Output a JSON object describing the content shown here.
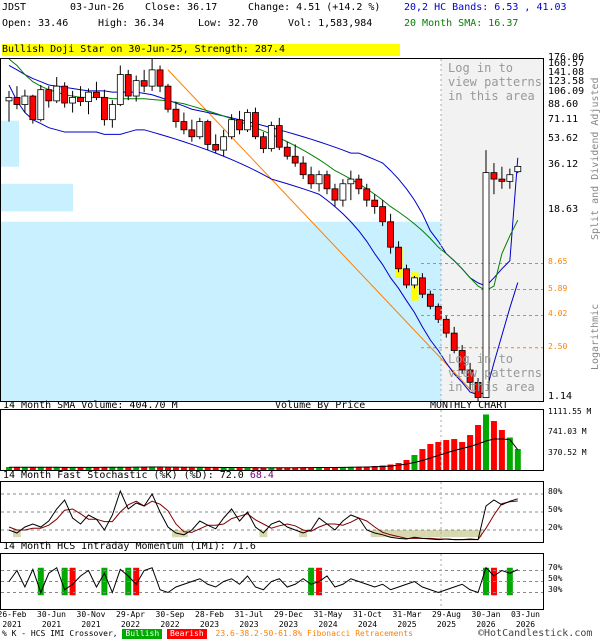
{
  "header": {
    "symbol": "JDST",
    "date": "03-Jun-26",
    "close_label": "Close: 36.17",
    "change_label": "Change: 4.51 (+14.2 %)",
    "open_label": "Open: 33.46",
    "high_label": "High: 36.34",
    "low_label": "Low: 32.70",
    "vol_label": "Vol: 1,583,984",
    "bands_label": "20,2 HC Bands: 6.53 , 41.03",
    "sma_label": "20 Month SMA: 16.37"
  },
  "pattern_banner": "Bullish Doji Star on 30-Jun-25, Strength: 287.4",
  "notes": {
    "top": "Log in to\nview patterns\nin this area",
    "bottom": "Log in to\nview patterns\nin this area"
  },
  "side_labels": {
    "split": "Split and Dividend Adjusted",
    "log": "Logarithmic"
  },
  "price_axis": {
    "labels": [
      "176.06",
      "160.57",
      "141.08",
      "123.58",
      "106.09",
      "88.60",
      "71.11",
      "53.62",
      "36.12",
      "18.63"
    ],
    "min_label": "1.14"
  },
  "fib_levels": [
    "8.65",
    "5.89",
    "4.02",
    "2.50"
  ],
  "volume_panel": {
    "title": "14 Month SMA Volume: 404.70 M",
    "vbp": "Volume By Price",
    "chart_kind": "MONTHLY CHART",
    "axis": [
      "1111.55 M",
      "741.03 M",
      "370.52 M"
    ]
  },
  "stoch_panel": {
    "title_prefix": "14 Month Fast Stochastic (%K) (%D): ",
    "k": "72.0",
    "d": "68.4",
    "axis": [
      "80%",
      "50%",
      "20%"
    ]
  },
  "imi_panel": {
    "title": "14 Month HCS Intraday Momentum (IMI): 71.6",
    "axis": [
      "70%",
      "50%",
      "30%"
    ]
  },
  "x_axis": [
    "26-Feb\n2021",
    "30-Jun\n2021",
    "30-Nov\n2021",
    "29-Apr\n2022",
    "30-Sep\n2022",
    "28-Feb\n2023",
    "31-Jul\n2023",
    "29-Dec\n2023",
    "31-May\n2024",
    "31-Oct\n2024",
    "31-Mar\n2025",
    "29-Aug\n2025",
    "30-Jan\n2026",
    "03-Jun\n2026"
  ],
  "footer": {
    "legend": "% K - HCS IMI Crossover,",
    "bullish": "Bullish",
    "bearish": "Bearish",
    "fib": "23.6-38.2-50-61.8% Fibonacci Retracements",
    "brand": "©HotCandlestick.com"
  },
  "colors": {
    "up": "#ffffff",
    "down": "#ff0000",
    "band": "#0000cc",
    "sma": "#008000",
    "vbp": "#c8f0ff",
    "fib": "#ff8000",
    "hilite": "#ffff00",
    "vol_up": "#00aa00",
    "vol_down": "#ff0000",
    "stoch_k": "#000000",
    "stoch_d": "#800000",
    "oversold": "#d8d8b0"
  },
  "chart_data": {
    "type": "candlestick",
    "scale": "log",
    "ylim": [
      1.14,
      176.06
    ],
    "x": [
      "Feb-21",
      "Mar-21",
      "Apr-21",
      "May-21",
      "Jun-21",
      "Jul-21",
      "Aug-21",
      "Sep-21",
      "Oct-21",
      "Nov-21",
      "Dec-21",
      "Jan-22",
      "Feb-22",
      "Mar-22",
      "Apr-22",
      "May-22",
      "Jun-22",
      "Jul-22",
      "Aug-22",
      "Sep-22",
      "Oct-22",
      "Nov-22",
      "Dec-22",
      "Jan-23",
      "Feb-23",
      "Mar-23",
      "Apr-23",
      "May-23",
      "Jun-23",
      "Jul-23",
      "Aug-23",
      "Sep-23",
      "Oct-23",
      "Nov-23",
      "Dec-23",
      "Jan-24",
      "Feb-24",
      "Mar-24",
      "Apr-24",
      "May-24",
      "Jun-24",
      "Jul-24",
      "Aug-24",
      "Sep-24",
      "Oct-24",
      "Nov-24",
      "Dec-24",
      "Jan-25",
      "Feb-25",
      "Mar-25",
      "Apr-25",
      "May-25",
      "Jun-25",
      "Jul-25",
      "Aug-25",
      "Sep-25",
      "Oct-25",
      "Nov-25",
      "Dec-25",
      "Jan-26",
      "Feb-26",
      "Mar-26",
      "Apr-26",
      "May-26",
      "Jun-26"
    ],
    "ohlc": [
      [
        95,
        110,
        70,
        100
      ],
      [
        100,
        118,
        84,
        90
      ],
      [
        90,
        112,
        80,
        102
      ],
      [
        102,
        104,
        68,
        72
      ],
      [
        72,
        120,
        70,
        112
      ],
      [
        112,
        118,
        86,
        95
      ],
      [
        95,
        135,
        92,
        118
      ],
      [
        118,
        125,
        86,
        92
      ],
      [
        92,
        110,
        80,
        100
      ],
      [
        100,
        118,
        88,
        94
      ],
      [
        94,
        114,
        78,
        108
      ],
      [
        108,
        126,
        96,
        100
      ],
      [
        100,
        112,
        66,
        72
      ],
      [
        72,
        96,
        64,
        90
      ],
      [
        90,
        160,
        88,
        140
      ],
      [
        140,
        150,
        96,
        102
      ],
      [
        102,
        138,
        94,
        128
      ],
      [
        128,
        150,
        108,
        118
      ],
      [
        118,
        176,
        110,
        150
      ],
      [
        150,
        160,
        108,
        118
      ],
      [
        118,
        122,
        80,
        84
      ],
      [
        84,
        94,
        64,
        70
      ],
      [
        70,
        80,
        58,
        62
      ],
      [
        62,
        72,
        52,
        56
      ],
      [
        56,
        74,
        54,
        70
      ],
      [
        70,
        72,
        46,
        50
      ],
      [
        50,
        58,
        44,
        46
      ],
      [
        46,
        62,
        42,
        56
      ],
      [
        56,
        78,
        54,
        72
      ],
      [
        72,
        82,
        58,
        62
      ],
      [
        62,
        84,
        60,
        80
      ],
      [
        80,
        86,
        54,
        56
      ],
      [
        56,
        60,
        44,
        47
      ],
      [
        47,
        70,
        45,
        66
      ],
      [
        66,
        74,
        46,
        48
      ],
      [
        48,
        52,
        40,
        42
      ],
      [
        42,
        50,
        36,
        38
      ],
      [
        38,
        42,
        30,
        32
      ],
      [
        32,
        36,
        26,
        28
      ],
      [
        28,
        34,
        25,
        32
      ],
      [
        32,
        34,
        24,
        26
      ],
      [
        26,
        28,
        20,
        22
      ],
      [
        22,
        30,
        20,
        28
      ],
      [
        28,
        34,
        22,
        30
      ],
      [
        30,
        32,
        24,
        26
      ],
      [
        26,
        28,
        20,
        22
      ],
      [
        22,
        24,
        18,
        20
      ],
      [
        20,
        22,
        15,
        16
      ],
      [
        16,
        18,
        10,
        11
      ],
      [
        11,
        12,
        7.6,
        8
      ],
      [
        8,
        8.5,
        6,
        6.3
      ],
      [
        6.3,
        7.2,
        6,
        7
      ],
      [
        7,
        7.5,
        5.2,
        5.5
      ],
      [
        5.5,
        5.8,
        4.4,
        4.6
      ],
      [
        4.6,
        4.8,
        3.6,
        3.8
      ],
      [
        3.8,
        4,
        2.9,
        3.1
      ],
      [
        3.1,
        3.4,
        2.3,
        2.4
      ],
      [
        2.4,
        2.6,
        1.7,
        1.8
      ],
      [
        1.8,
        2,
        1.35,
        1.5
      ],
      [
        1.5,
        1.6,
        1.14,
        1.2
      ],
      [
        1.2,
        46,
        1.2,
        33
      ],
      [
        33,
        38,
        24,
        30
      ],
      [
        30,
        36,
        26,
        29
      ],
      [
        29,
        35,
        26,
        32
      ],
      [
        33.46,
        36.34,
        32.7,
        36.17
      ]
    ],
    "upper_band": [
      160,
      150,
      140,
      132,
      126,
      120,
      118,
      116,
      114,
      112,
      110,
      110,
      110,
      108,
      108,
      108,
      108,
      106,
      104,
      100,
      96,
      92,
      88,
      84,
      82,
      80,
      78,
      76,
      74,
      72,
      70,
      68,
      66,
      64,
      62,
      60,
      58,
      56,
      54,
      52,
      50,
      48,
      46,
      44,
      44,
      42,
      40,
      38,
      34,
      30,
      26,
      22,
      18,
      14,
      12,
      10,
      9,
      8,
      7,
      6.5,
      6.2,
      7,
      8,
      9,
      41.03
    ],
    "lower_band": [
      120,
      95,
      80,
      72,
      68,
      64,
      62,
      60,
      60,
      60,
      60,
      60,
      58,
      58,
      58,
      60,
      62,
      62,
      60,
      58,
      56,
      54,
      52,
      50,
      48,
      46,
      44,
      42,
      40,
      38,
      36,
      34,
      32,
      30,
      29,
      28,
      27,
      26,
      25,
      24,
      22,
      20,
      18,
      16,
      14,
      12,
      10,
      8.5,
      7,
      6,
      5,
      4.2,
      3.4,
      2.8,
      2.4,
      2,
      1.7,
      1.5,
      1.3,
      1.25,
      1.3,
      2,
      3,
      4.5,
      6.53
    ],
    "sma": [
      176,
      160,
      140,
      126,
      118,
      112,
      108,
      104,
      102,
      100,
      100,
      100,
      100,
      98,
      98,
      98,
      98,
      98,
      97,
      96,
      95,
      93,
      91,
      88,
      85,
      82,
      79,
      76,
      73,
      70,
      67,
      64,
      61,
      58,
      55,
      52,
      49,
      46,
      43,
      40,
      37,
      34,
      32,
      30,
      28,
      26,
      24,
      22,
      20,
      18.5,
      17,
      15.5,
      14,
      12.5,
      11,
      10,
      9,
      8,
      7,
      6.2,
      5.8,
      6.2,
      10,
      13,
      16.37
    ],
    "volume_ytick_max": 1111.55,
    "volume": [
      60,
      55,
      50,
      60,
      55,
      50,
      55,
      50,
      48,
      52,
      50,
      55,
      60,
      58,
      62,
      60,
      58,
      62,
      70,
      60,
      55,
      52,
      50,
      48,
      52,
      50,
      48,
      46,
      50,
      48,
      46,
      45,
      44,
      46,
      44,
      42,
      44,
      48,
      50,
      52,
      55,
      58,
      60,
      62,
      65,
      70,
      80,
      90,
      110,
      140,
      200,
      300,
      420,
      520,
      560,
      600,
      620,
      560,
      700,
      900,
      1111,
      980,
      800,
      650,
      420
    ],
    "volume_sma": [
      55,
      55,
      54,
      54,
      54,
      54,
      54,
      53,
      53,
      53,
      53,
      53,
      54,
      54,
      55,
      56,
      57,
      58,
      59,
      59,
      58,
      57,
      56,
      55,
      54,
      53,
      52,
      51,
      50,
      49,
      48,
      47,
      46,
      46,
      46,
      46,
      46,
      47,
      48,
      49,
      50,
      51,
      53,
      55,
      57,
      60,
      65,
      70,
      80,
      95,
      120,
      150,
      190,
      240,
      290,
      340,
      390,
      430,
      470,
      520,
      580,
      620,
      620,
      610,
      404.7
    ],
    "stoch_k": [
      20,
      15,
      25,
      30,
      25,
      35,
      55,
      70,
      40,
      30,
      45,
      38,
      20,
      45,
      85,
      55,
      65,
      60,
      80,
      50,
      25,
      15,
      12,
      20,
      35,
      28,
      22,
      40,
      55,
      35,
      50,
      25,
      15,
      30,
      35,
      25,
      20,
      15,
      20,
      40,
      30,
      20,
      35,
      45,
      40,
      20,
      15,
      12,
      8,
      6,
      5,
      8,
      6,
      5,
      4,
      5,
      4,
      4,
      5,
      4,
      60,
      70,
      62,
      68,
      72
    ],
    "stoch_d": [
      25,
      20,
      20,
      23,
      23,
      28,
      38,
      53,
      55,
      47,
      38,
      38,
      34,
      34,
      50,
      62,
      68,
      60,
      68,
      63,
      52,
      30,
      17,
      16,
      22,
      28,
      28,
      30,
      39,
      43,
      47,
      37,
      30,
      23,
      27,
      30,
      27,
      20,
      18,
      25,
      30,
      30,
      28,
      33,
      40,
      35,
      25,
      16,
      12,
      9,
      6,
      6,
      6,
      6,
      5,
      5,
      4,
      4,
      4,
      4,
      23,
      45,
      64,
      67,
      68.4
    ],
    "imi": [
      50,
      70,
      40,
      72,
      30,
      65,
      75,
      35,
      45,
      60,
      70,
      40,
      65,
      30,
      72,
      60,
      45,
      70,
      75,
      35,
      30,
      40,
      45,
      50,
      55,
      45,
      40,
      50,
      55,
      45,
      60,
      40,
      35,
      50,
      55,
      40,
      45,
      55,
      45,
      50,
      60,
      40,
      45,
      55,
      50,
      45,
      40,
      45,
      35,
      40,
      45,
      50,
      40,
      35,
      30,
      35,
      40,
      45,
      35,
      30,
      75,
      60,
      70,
      65,
      71.6
    ],
    "imi_bars": [
      [
        4,
        "bull"
      ],
      [
        7,
        "bull"
      ],
      [
        8,
        "bear"
      ],
      [
        12,
        "bull"
      ],
      [
        15,
        "bull"
      ],
      [
        16,
        "bear"
      ],
      [
        38,
        "bull"
      ],
      [
        39,
        "bear"
      ],
      [
        60,
        "bull"
      ],
      [
        61,
        "bear"
      ],
      [
        63,
        "bull"
      ]
    ]
  }
}
